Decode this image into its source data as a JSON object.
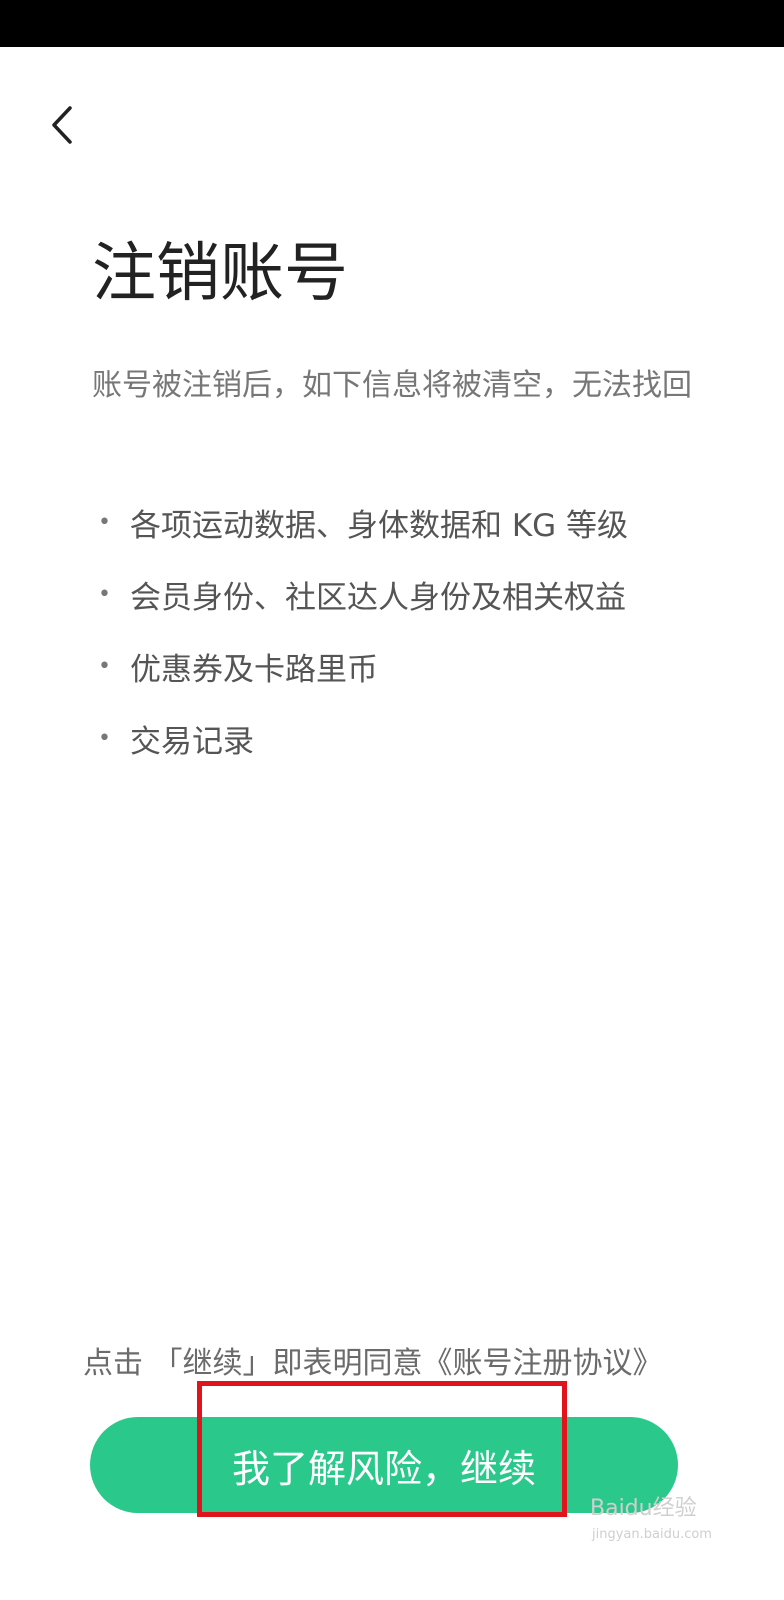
{
  "header": {
    "back_icon": "chevron-left-icon"
  },
  "page": {
    "title": "注销账号",
    "subtitle": "账号被注销后，如下信息将被清空，无法找回",
    "bullet_glyph": "•",
    "items": [
      "各项运动数据、身体数据和 KG 等级",
      "会员身份、社区达人身份及相关权益",
      "优惠券及卡路里币",
      "交易记录"
    ]
  },
  "footer": {
    "agreement_text": "点击 「继续」即表明同意《账号注册协议》",
    "continue_label": "我了解风险，继续",
    "accent_color": "#2bc88c"
  },
  "annotation": {
    "highlight_color": "#e0141c"
  },
  "watermark": {
    "text": "Baidu经验",
    "sub": "jingyan.baidu.com"
  }
}
